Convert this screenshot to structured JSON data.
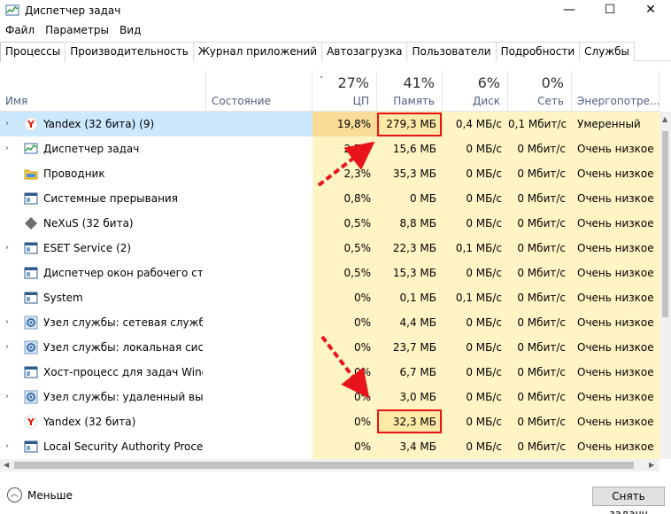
{
  "window": {
    "title": "Диспетчер задач",
    "min": "—",
    "max": "☐",
    "close": "✕"
  },
  "menu": [
    "Файл",
    "Параметры",
    "Вид"
  ],
  "tabs": [
    "Процессы",
    "Производительность",
    "Журнал приложений",
    "Автозагрузка",
    "Пользователи",
    "Подробности",
    "Службы"
  ],
  "columns": {
    "name": "Имя",
    "status": "Состояние",
    "cpu": {
      "pct": "27%",
      "label": "ЦП"
    },
    "mem": {
      "pct": "41%",
      "label": "Память"
    },
    "disk": {
      "pct": "6%",
      "label": "Диск"
    },
    "net": {
      "pct": "0%",
      "label": "Сеть"
    },
    "energy": {
      "label": "Энергопотре..."
    }
  },
  "rows": [
    {
      "name": "Yandex (32 бита) (9)",
      "icon": "yandex-icon",
      "expand": true,
      "cpu": "19,8%",
      "mem": "279,3 МБ",
      "disk": "0,4 МБ/с",
      "net": "0,1 Мбит/с",
      "energy": "Умеренный"
    },
    {
      "name": "Диспетчер задач",
      "icon": "taskmgr-icon",
      "expand": true,
      "cpu": "2,7%",
      "mem": "15,6 МБ",
      "disk": "0 МБ/с",
      "net": "0 Мбит/с",
      "energy": "Очень низкое"
    },
    {
      "name": "Проводник",
      "icon": "folder-icon",
      "expand": false,
      "cpu": "2,3%",
      "mem": "35,3 МБ",
      "disk": "0 МБ/с",
      "net": "0 Мбит/с",
      "energy": "Очень низкое"
    },
    {
      "name": "Системные прерывания",
      "icon": "system-icon",
      "expand": false,
      "cpu": "0,8%",
      "mem": "0 МБ",
      "disk": "0 МБ/с",
      "net": "0 Мбит/с",
      "energy": "Очень низкое"
    },
    {
      "name": "NeXuS (32 бита)",
      "icon": "nexus-icon",
      "expand": false,
      "cpu": "0,5%",
      "mem": "8,8 МБ",
      "disk": "0 МБ/с",
      "net": "0 Мбит/с",
      "energy": "Очень низкое"
    },
    {
      "name": "ESET Service (2)",
      "icon": "system-icon",
      "expand": true,
      "cpu": "0,5%",
      "mem": "22,3 МБ",
      "disk": "0,1 МБ/с",
      "net": "0 Мбит/с",
      "energy": "Очень низкое"
    },
    {
      "name": "Диспетчер окон рабочего стола",
      "icon": "system-icon",
      "expand": false,
      "cpu": "0,5%",
      "mem": "15,3 МБ",
      "disk": "0 МБ/с",
      "net": "0 Мбит/с",
      "energy": "Очень низкое"
    },
    {
      "name": "System",
      "icon": "system-icon",
      "expand": false,
      "cpu": "0%",
      "mem": "0,1 МБ",
      "disk": "0,1 МБ/с",
      "net": "0 Мбит/с",
      "energy": "Очень низкое"
    },
    {
      "name": "Узел службы: сетевая служба ...",
      "icon": "gear-icon",
      "expand": true,
      "cpu": "0%",
      "mem": "4,4 МБ",
      "disk": "0 МБ/с",
      "net": "0 Мбит/с",
      "energy": "Очень низкое"
    },
    {
      "name": "Узел службы: локальная систе...",
      "icon": "gear-icon",
      "expand": true,
      "cpu": "0%",
      "mem": "23,7 МБ",
      "disk": "0 МБ/с",
      "net": "0 Мбит/с",
      "energy": "Очень низкое"
    },
    {
      "name": "Хост-процесс для задач Windo...",
      "icon": "system-icon",
      "expand": false,
      "cpu": "0%",
      "mem": "6,7 МБ",
      "disk": "0 МБ/с",
      "net": "0 Мбит/с",
      "energy": "Очень низкое"
    },
    {
      "name": "Узел службы: удаленный вызо...",
      "icon": "gear-icon",
      "expand": true,
      "cpu": "0%",
      "mem": "3,0 МБ",
      "disk": "0 МБ/с",
      "net": "0 Мбит/с",
      "energy": "Очень низкое"
    },
    {
      "name": "Yandex (32 бита)",
      "icon": "yandex-icon",
      "expand": false,
      "cpu": "0%",
      "mem": "32,3 МБ",
      "disk": "0 МБ/с",
      "net": "0 Мбит/с",
      "energy": "Очень низкое"
    },
    {
      "name": "Local Security Authority Process...",
      "icon": "system-icon",
      "expand": true,
      "cpu": "0%",
      "mem": "3,4 МБ",
      "disk": "0 МБ/с",
      "net": "0 Мбит/с",
      "energy": "Очень низкое"
    }
  ],
  "footer": {
    "less": "Меньше",
    "end_task": "Снять задачу"
  },
  "colors": {
    "heat_light": "#fff4c4",
    "heat_medium": "#ffe9a6",
    "heat_strong": "#f8dc97",
    "highlight": "#e8141c"
  }
}
